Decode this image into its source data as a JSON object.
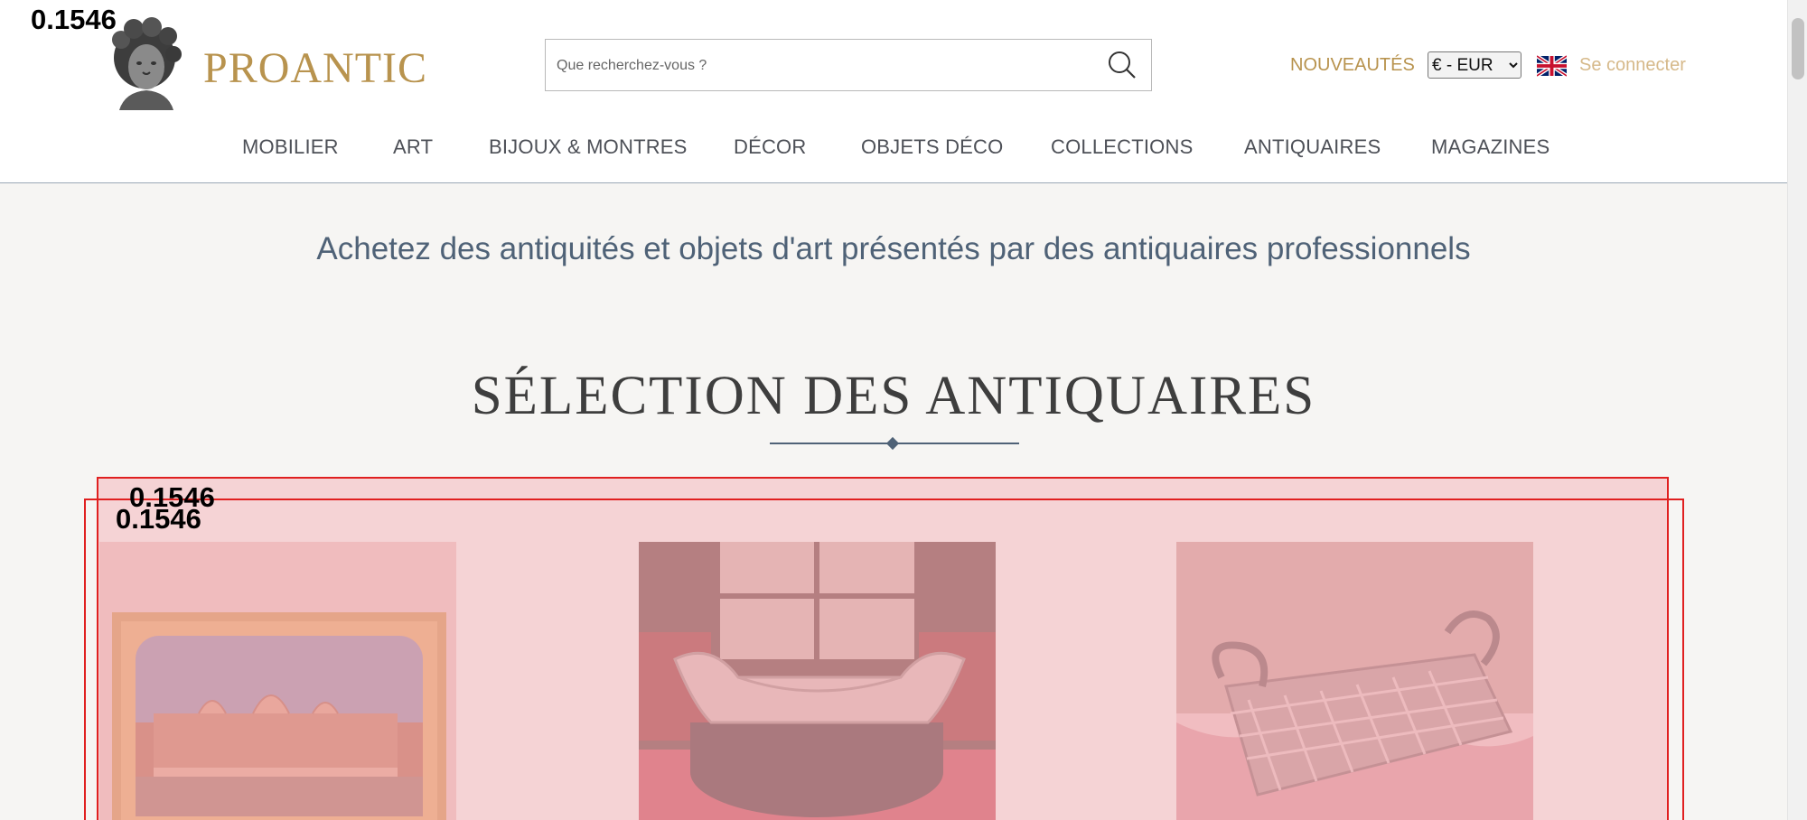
{
  "header": {
    "logo_text": "PROANTIC",
    "search_placeholder": "Que recherchez-vous ?",
    "nouveautes_label": "NOUVEAUTÉS",
    "currency": {
      "selected": "€ - EUR",
      "options": [
        "€ - EUR"
      ]
    },
    "language_flag": "uk-flag-icon",
    "login_label": "Se connecter"
  },
  "nav": {
    "items": [
      {
        "label": "MOBILIER"
      },
      {
        "label": "ART"
      },
      {
        "label": "BIJOUX & MONTRES"
      },
      {
        "label": "DÉCOR"
      },
      {
        "label": "OBJETS DÉCO"
      },
      {
        "label": "COLLECTIONS"
      },
      {
        "label": "ANTIQUAIRES"
      },
      {
        "label": "MAGAZINES"
      }
    ]
  },
  "intro_text": "Achetez des antiquités et objets d'art présentés par des antiquaires professionnels",
  "section_title": "SÉLECTION DES ANTIQUAIRES",
  "detection_scores": {
    "logo_score": "0.1546",
    "outer_box_score": "0.1546",
    "inner_box_score": "0.1546"
  },
  "products": [
    {
      "image": "framed-venice-painting-image"
    },
    {
      "image": "silver-jardiniere-image"
    },
    {
      "image": "silver-woven-basket-image"
    }
  ],
  "colors": {
    "brand_gold": "#b8934e",
    "nav_text": "#4d5057",
    "intro_blue": "#4f6277",
    "highlight_red": "#e02020"
  }
}
